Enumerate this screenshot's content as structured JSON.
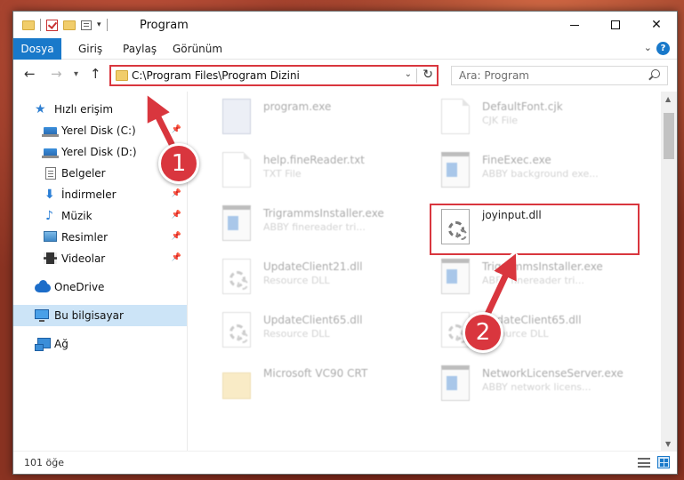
{
  "window": {
    "title": "Program"
  },
  "ribbon": {
    "tabs": [
      "Dosya",
      "Giriş",
      "Paylaş",
      "Görünüm"
    ]
  },
  "navigation": {
    "address": "C:\\Program Files\\Program Dizini",
    "search_placeholder": "Ara: Program"
  },
  "sidebar": {
    "items": [
      {
        "label": "Hızlı erişim",
        "icon": "star-icon"
      },
      {
        "label": "Yerel Disk (C:)",
        "icon": "disk-icon",
        "pinned": true
      },
      {
        "label": "Yerel Disk (D:)",
        "icon": "disk-icon"
      },
      {
        "label": "Belgeler",
        "icon": "documents-icon"
      },
      {
        "label": "İndirmeler",
        "icon": "download-icon",
        "pinned": true
      },
      {
        "label": "Müzik",
        "icon": "music-icon",
        "pinned": true
      },
      {
        "label": "Resimler",
        "icon": "pictures-icon",
        "pinned": true
      },
      {
        "label": "Videolar",
        "icon": "videos-icon",
        "pinned": true
      },
      {
        "label": "OneDrive",
        "icon": "cloud-icon"
      },
      {
        "label": "Bu bilgisayar",
        "icon": "computer-icon",
        "selected": true
      },
      {
        "label": "Ağ",
        "icon": "network-icon"
      }
    ]
  },
  "files": [
    {
      "name": "program.exe",
      "type": "",
      "icon": "program-icon"
    },
    {
      "name": "DefaultFont.cjk",
      "type": "CJK File",
      "icon": "page-icon"
    },
    {
      "name": "help.fineReader.txt",
      "type": "TXT File",
      "icon": "page-icon"
    },
    {
      "name": "FineExec.exe",
      "type": "ABBY background exe...",
      "icon": "exe-icon"
    },
    {
      "name": "TrigrammsInstaller.exe",
      "type": "ABBY finereader tri...",
      "icon": "exe-icon"
    },
    {
      "name": "joyinput.dll",
      "type": "",
      "icon": "dll-icon"
    },
    {
      "name": "UpdateClient21.dll",
      "type": "Resource DLL",
      "icon": "dll-icon"
    },
    {
      "name": "TrigrammsInstaller.exe",
      "type": "ABBY finereader tri...",
      "icon": "exe-icon"
    },
    {
      "name": "UpdateClient65.dll",
      "type": "Resource DLL",
      "icon": "dll-icon"
    },
    {
      "name": "UpdateClient65.dll",
      "type": "Resource DLL",
      "icon": "dll-icon"
    },
    {
      "name": "Microsoft VC90 CRT",
      "type": "",
      "icon": "folder-icon"
    },
    {
      "name": "NetworkLicenseServer.exe",
      "type": "ABBY network licens...",
      "icon": "exe-icon"
    }
  ],
  "status": {
    "count": "101 öğe"
  },
  "annotations": {
    "step1": "1",
    "step2": "2",
    "accent": "#d9363e"
  }
}
